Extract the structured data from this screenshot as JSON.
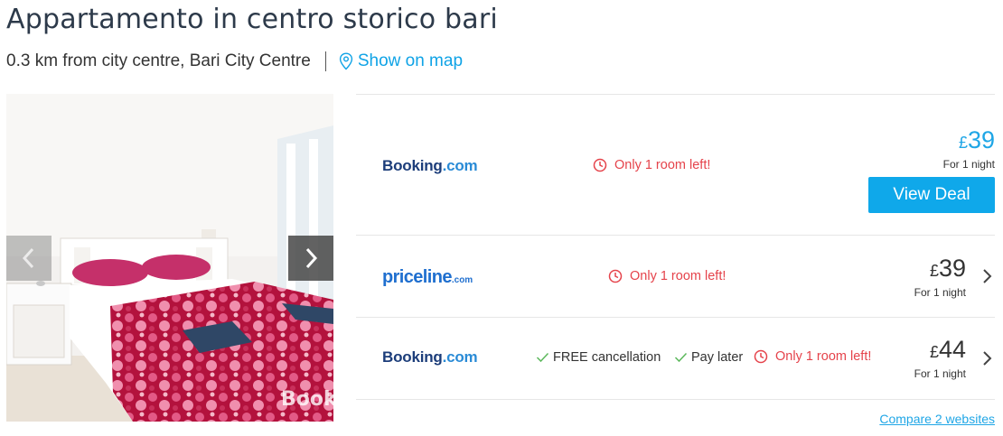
{
  "hotel": {
    "name": "Appartamento in centro storico bari",
    "distance": "0.3 km from city centre, Bari City Centre",
    "map_link": "Show on map"
  },
  "gallery": {
    "watermark": "Booki",
    "prev_icon": "chevron-left-icon",
    "next_icon": "chevron-right-icon"
  },
  "deals": [
    {
      "provider_main": "Booking",
      "provider_suffix": ".com",
      "urgency": "Only 1 room left!",
      "currency": "£",
      "amount": "39",
      "per_night": "For 1 night",
      "cta": "View Deal"
    },
    {
      "provider_main": "priceline",
      "provider_suffix": ".com",
      "urgency": "Only 1 room left!",
      "currency": "£",
      "amount": "39",
      "per_night": "For 1 night"
    },
    {
      "provider_main": "Booking",
      "provider_suffix": ".com",
      "perks": [
        "FREE cancellation",
        "Pay later"
      ],
      "urgency": "Only 1 room left!",
      "currency": "£",
      "amount": "44",
      "per_night": "For 1 night"
    }
  ],
  "compare_link": "Compare 2 websites",
  "colors": {
    "accent": "#0fa8ea",
    "urgency": "#e5434b",
    "perk_check": "#5cb85c",
    "title": "#2d3a4a"
  }
}
